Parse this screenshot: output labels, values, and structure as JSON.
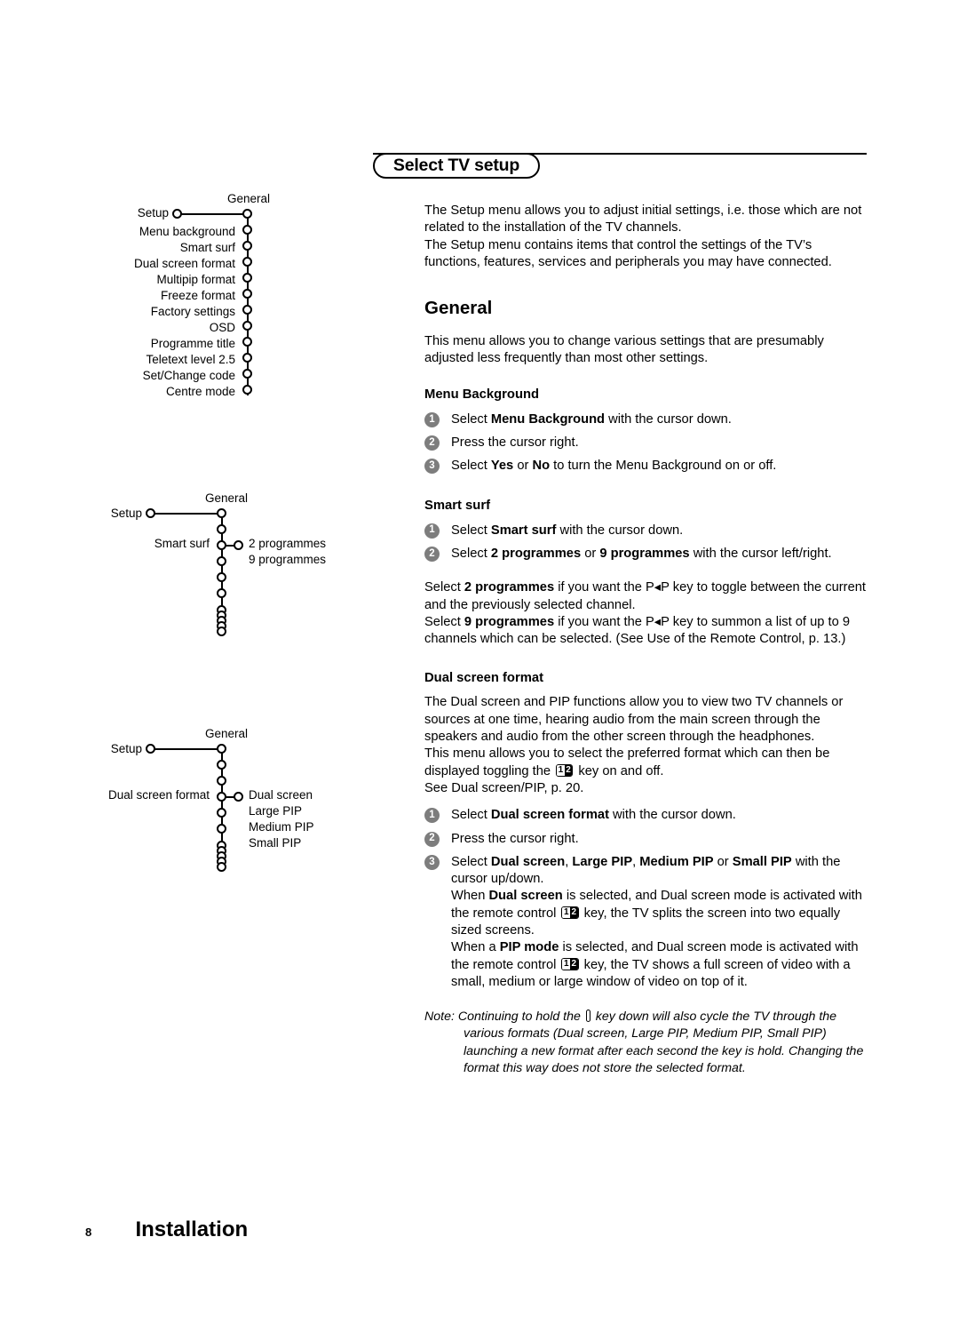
{
  "header": {
    "title": "Select TV setup"
  },
  "diagrams": [
    {
      "name": "general-menu-tree",
      "root_label": "Setup",
      "column_label": "General",
      "items": [
        "Menu background",
        "Smart surf",
        "Dual screen format",
        "Multipip format",
        "Freeze format",
        "Factory settings",
        "OSD",
        "Programme title",
        "Teletext level 2.5",
        "Set/Change code",
        "Centre mode"
      ],
      "options": []
    },
    {
      "name": "smart-surf-tree",
      "root_label": "Setup",
      "column_label": "General",
      "selected_label": "Smart surf",
      "options": [
        "2 programmes",
        "9 programmes"
      ]
    },
    {
      "name": "dual-screen-format-tree",
      "root_label": "Setup",
      "column_label": "General",
      "selected_label": "Dual screen format",
      "options": [
        "Dual screen",
        "Large PIP",
        "Medium PIP",
        "Small PIP"
      ]
    }
  ],
  "content": {
    "intro_p1": "The Setup menu allows you to adjust initial settings, i.e. those which are not related to the installation of the TV channels.",
    "intro_p2": "The Setup menu contains items that control the settings of the TV’s functions, features, services and peripherals you may have connected.",
    "general": {
      "heading": "General",
      "paragraph": "This menu allows you to change various settings that are presumably adjusted less frequently than most other settings."
    },
    "menu_background": {
      "heading": "Menu Background",
      "steps": [
        {
          "num": "1",
          "text_parts": [
            "Select ",
            "Menu Background",
            " with the cursor down."
          ]
        },
        {
          "num": "2",
          "text_parts": [
            "Press the cursor right."
          ]
        },
        {
          "num": "3",
          "text_parts": [
            "Select ",
            "Yes",
            " or ",
            "No",
            " to turn the Menu Background on or off."
          ]
        }
      ]
    },
    "smart_surf": {
      "heading": "Smart surf",
      "steps": [
        {
          "num": "1",
          "text_parts": [
            "Select ",
            "Smart surf",
            " with the cursor down."
          ]
        },
        {
          "num": "2",
          "text_parts": [
            "Select ",
            "2 programmes",
            " or ",
            "9 programmes",
            " with the cursor left/right."
          ]
        }
      ],
      "body_1_a": "Select ",
      "body_1_b": "2 programmes",
      "body_1_c": " if you want the ",
      "body_1_key": "P◂P",
      "body_1_d": " key to toggle between the current and the previously selected channel.",
      "body_2_a": "Select ",
      "body_2_b": "9 programmes",
      "body_2_c": " if you want the ",
      "body_2_key": "P◂P",
      "body_2_d": " key to summon a list of up to 9 channels which can be selected. (See Use of the Remote Control, p. 13.)"
    },
    "dual_screen_format": {
      "heading": "Dual screen format",
      "para_1": "The Dual screen and PIP functions allow you to view two TV channels or sources at one time, hearing audio from the main screen through the speakers and audio from the other screen through the headphones.",
      "para_2_a": "This menu allows you to select the preferred format which can then be displayed toggling the ",
      "para_2_b": " key on and off.",
      "para_3": "See Dual screen/PIP, p. 20.",
      "steps": [
        {
          "num": "1",
          "text_parts": [
            "Select ",
            "Dual screen format",
            " with the cursor down."
          ]
        },
        {
          "num": "2",
          "text_parts": [
            "Press the cursor right."
          ]
        }
      ],
      "step3_num": "3",
      "step3_a": "Select ",
      "step3_b": "Dual screen",
      "step3_c": ", ",
      "step3_d": "Large PIP",
      "step3_e": ", ",
      "step3_f": "Medium PIP",
      "step3_g": " or ",
      "step3_h": "Small PIP",
      "step3_i": " with the cursor up/down.",
      "step3_when1_a": "When ",
      "step3_when1_b": "Dual screen",
      "step3_when1_c": " is selected, and Dual screen mode is activated with the remote control ",
      "step3_when1_d": " key, the TV splits the screen into two equally sized screens.",
      "step3_when2_a": "When a ",
      "step3_when2_b": "PIP mode",
      "step3_when2_c": " is selected, and Dual screen mode is activated with the remote control ",
      "step3_when2_d": " key, the TV shows a full screen of video with a small, medium or large window of video on top of it."
    },
    "note": {
      "label": "Note: ",
      "part_a": "Continuing to hold the ",
      "part_b": " key down will also cycle the TV through the various formats (Dual screen, Large PIP, Medium PIP, Small PIP) launching a new format after each second the key is hold. Changing the format this way does not store the selected format."
    },
    "key_glyph": {
      "left": "1",
      "right": "2"
    }
  },
  "footer": {
    "page_number": "8",
    "chapter": "Installation"
  },
  "colors": {
    "bullet_gray": "#7d7d7d",
    "ink": "#000000",
    "page": "#ffffff"
  }
}
